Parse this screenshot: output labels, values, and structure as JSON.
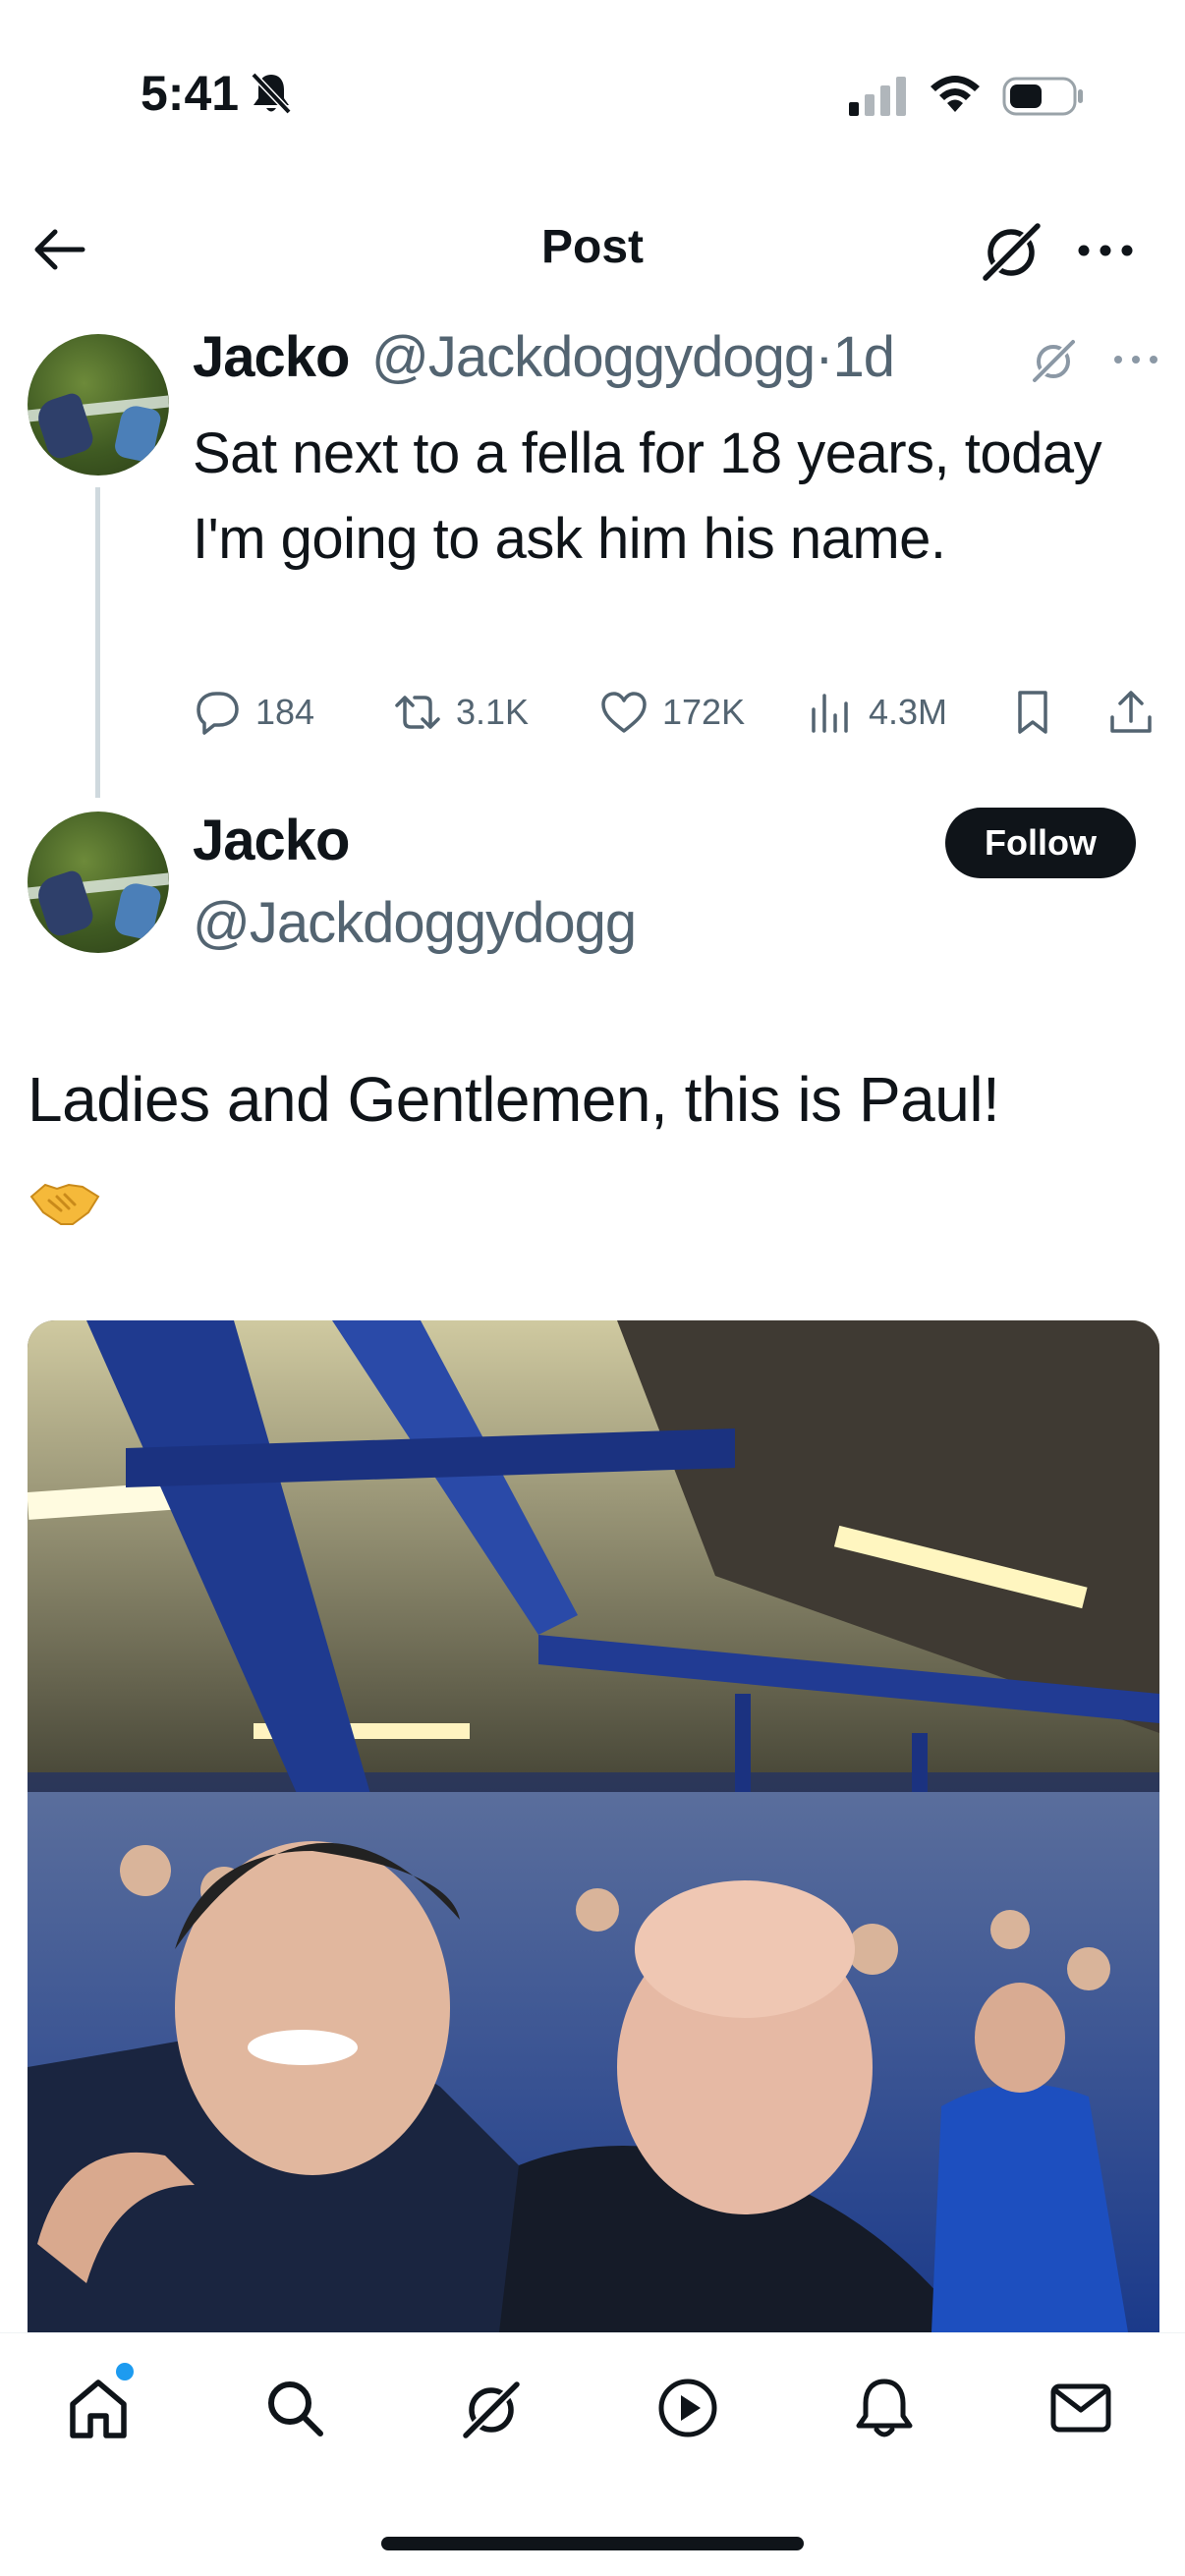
{
  "status_bar": {
    "time": "5:41",
    "icons": [
      "bell-off-icon",
      "cellular-signal-icon",
      "wifi-icon",
      "battery-icon"
    ]
  },
  "header": {
    "title": "Post",
    "back_icon": "arrow-left-icon",
    "grok_icon": "grok-icon",
    "more_icon": "more-horizontal-icon"
  },
  "parent_post": {
    "author_name": "Jacko",
    "author_handle": "@Jackdoggydogg",
    "time_ago": "·1d",
    "text": "Sat next to a fella for 18 years, today I'm going to ask him his name.",
    "stats": {
      "replies": "184",
      "reposts": "3.1K",
      "likes": "172K",
      "views": "4.3M"
    }
  },
  "main_post": {
    "author_name": "Jacko",
    "author_handle": "@Jackdoggydogg",
    "follow_label": "Follow",
    "text": "Ladies and Gentlemen, this is Paul!",
    "emoji": "handshake-emoji",
    "media": "photo"
  },
  "tabbar": {
    "tabs": [
      "home-icon",
      "search-icon",
      "grok-icon",
      "video-icon",
      "notifications-icon",
      "messages-icon"
    ],
    "active": "home-icon",
    "accent_color": "#1d9bf0"
  }
}
